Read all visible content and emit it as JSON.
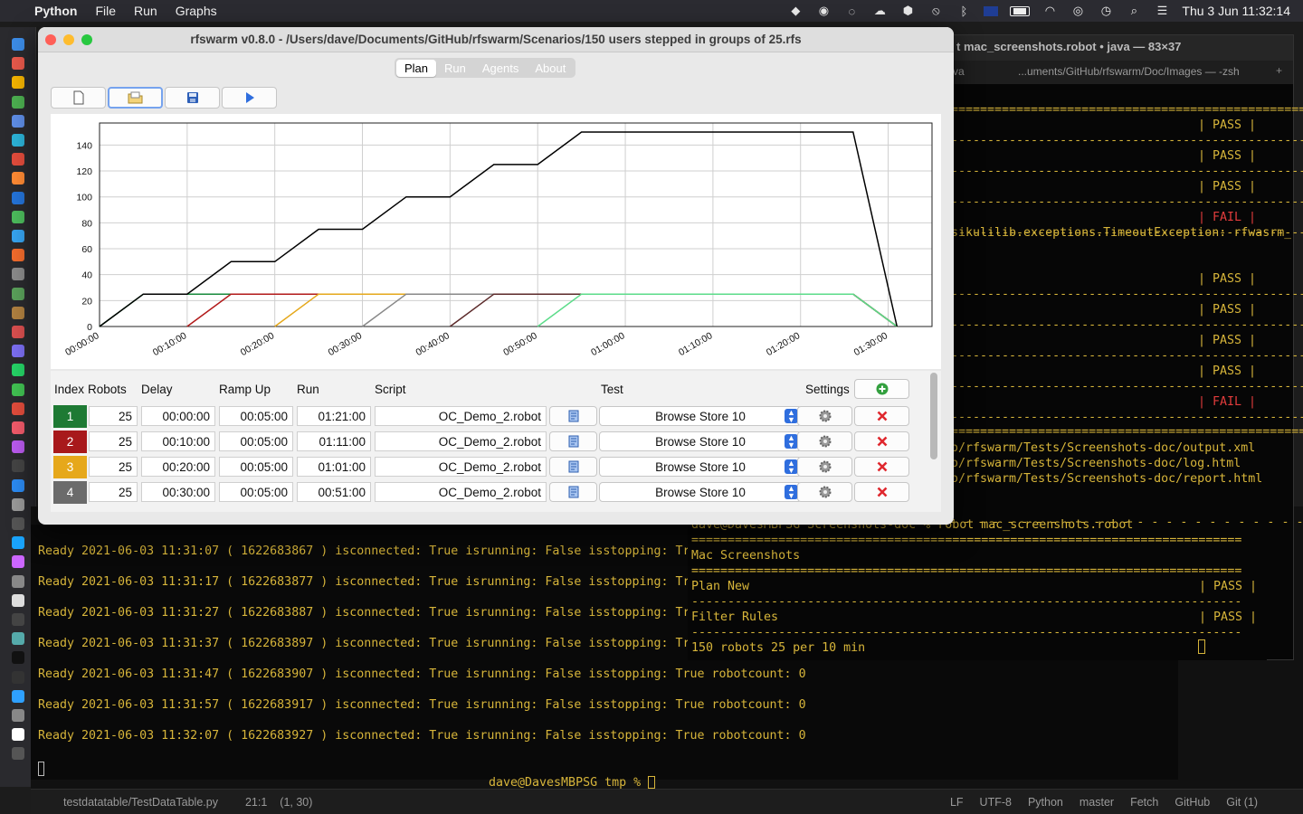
{
  "menubar": {
    "apple": "",
    "app": "Python",
    "menus": [
      "File",
      "Run",
      "Graphs"
    ],
    "clock": "Thu 3 Jun  11:32:14"
  },
  "window": {
    "title": "rfswarm v0.8.0 - /Users/dave/Documents/GitHub/rfswarm/Scenarios/150 users stepped in groups of 25.rfs",
    "tabs": [
      "Plan",
      "Run",
      "Agents",
      "About"
    ],
    "active_tab": "Plan"
  },
  "chart_data": {
    "type": "line",
    "xlabel": "",
    "ylabel": "",
    "xlim": [
      0,
      5700
    ],
    "ylim": [
      0,
      157
    ],
    "x_ticks": [
      "00:00:00",
      "00:10:00",
      "00:20:00",
      "00:30:00",
      "00:40:00",
      "00:50:00",
      "01:00:00",
      "01:10:00",
      "01:20:00",
      "01:30:00"
    ],
    "y_ticks": [
      0,
      20,
      40,
      60,
      80,
      100,
      120,
      140
    ],
    "grid": true,
    "series": [
      {
        "color": "#000000",
        "points": [
          [
            0,
            0
          ],
          [
            300,
            25
          ],
          [
            600,
            25
          ],
          [
            900,
            50
          ],
          [
            1200,
            50
          ],
          [
            1500,
            75
          ],
          [
            1800,
            75
          ],
          [
            2100,
            100
          ],
          [
            2400,
            100
          ],
          [
            2700,
            125
          ],
          [
            3000,
            125
          ],
          [
            3300,
            150
          ],
          [
            5160,
            150
          ],
          [
            5460,
            0
          ]
        ]
      },
      {
        "color": "#188a3c",
        "points": [
          [
            0,
            0
          ],
          [
            300,
            25
          ],
          [
            5160,
            25
          ],
          [
            5460,
            0
          ]
        ]
      },
      {
        "color": "#b21a1a",
        "points": [
          [
            600,
            0
          ],
          [
            900,
            25
          ],
          [
            5160,
            25
          ],
          [
            5460,
            0
          ]
        ]
      },
      {
        "color": "#e5a81b",
        "points": [
          [
            1200,
            0
          ],
          [
            1500,
            25
          ],
          [
            5160,
            25
          ],
          [
            5460,
            0
          ]
        ]
      },
      {
        "color": "#888888",
        "points": [
          [
            1800,
            0
          ],
          [
            2100,
            25
          ],
          [
            5160,
            25
          ],
          [
            5460,
            0
          ]
        ]
      },
      {
        "color": "#5c2a2a",
        "points": [
          [
            2400,
            0
          ],
          [
            2700,
            25
          ],
          [
            5160,
            25
          ],
          [
            5460,
            0
          ]
        ]
      },
      {
        "color": "#5cdc8a",
        "points": [
          [
            3000,
            0
          ],
          [
            3300,
            25
          ],
          [
            5160,
            25
          ],
          [
            5460,
            0
          ]
        ]
      }
    ]
  },
  "plan": {
    "headers": {
      "index": "Index",
      "robots": "Robots",
      "delay": "Delay",
      "rampup": "Ramp Up",
      "run": "Run",
      "script": "Script",
      "test": "Test",
      "settings": "Settings"
    },
    "rows": [
      {
        "index": "1",
        "color": "#1e7a34",
        "robots": "25",
        "delay": "00:00:00",
        "rampup": "00:05:00",
        "run": "01:21:00",
        "script": "OC_Demo_2.robot",
        "test": "Browse Store 10"
      },
      {
        "index": "2",
        "color": "#a8191b",
        "robots": "25",
        "delay": "00:10:00",
        "rampup": "00:05:00",
        "run": "01:11:00",
        "script": "OC_Demo_2.robot",
        "test": "Browse Store 10"
      },
      {
        "index": "3",
        "color": "#e6a81b",
        "robots": "25",
        "delay": "00:20:00",
        "rampup": "00:05:00",
        "run": "01:01:00",
        "script": "OC_Demo_2.robot",
        "test": "Browse Store 10"
      },
      {
        "index": "4",
        "color": "#6b6b6b",
        "robots": "25",
        "delay": "00:30:00",
        "rampup": "00:05:00",
        "run": "00:51:00",
        "script": "OC_Demo_2.robot",
        "test": "Browse Store 10"
      }
    ]
  },
  "term_left": {
    "lines": [
      "Ready 2021-06-03 11:31:07 ( 1622683867 ) isconnected: True isrunning: False isstopping: Tr",
      "Ready 2021-06-03 11:31:17 ( 1622683877 ) isconnected: True isrunning: False isstopping: Tr",
      "Ready 2021-06-03 11:31:27 ( 1622683887 ) isconnected: True isrunning: False isstopping: Tr",
      "Ready 2021-06-03 11:31:37 ( 1622683897 ) isconnected: True isrunning: False isstopping: Tr",
      "Ready 2021-06-03 11:31:47 ( 1622683907 ) isconnected: True isrunning: False isstopping: True robotcount: 0",
      "Ready 2021-06-03 11:31:57 ( 1622683917 ) isconnected: True isrunning: False isstopping: True robotcount: 0",
      "Ready 2021-06-03 11:32:07 ( 1622683927 ) isconnected: True isrunning: False isstopping: True robotcount: 0"
    ]
  },
  "term_right": {
    "title": "t mac_screenshots.robot • java — 83×37",
    "tab": "...uments/GitHub/rfswarm/Doc/Images — -zsh",
    "tab_left": "va",
    "plus": "+",
    "results": [
      "| PASS |",
      "| PASS |",
      "| PASS |",
      "| FAIL |",
      "| PASS |",
      "| PASS |",
      "| PASS |",
      "| PASS |",
      "| FAIL |"
    ],
    "exception": "sikulilib.exceptions.TimeoutException: rfwasrm_",
    "paths": [
      "o/rfswarm/Tests/Screenshots-doc/output.xml",
      "o/rfswarm/Tests/Screenshots-doc/log.html",
      "o/rfswarm/Tests/Screenshots-doc/report.html"
    ]
  },
  "term_mid": {
    "command": "dave@DavesMBPSG Screenshots-doc % robot mac_screenshots.robot",
    "suite": "Mac Screenshots",
    "tests": [
      {
        "name": "Plan New",
        "result": "| PASS |"
      },
      {
        "name": "Filter Rules",
        "result": "| PASS |"
      }
    ],
    "running": "150 robots 25 per 10 min"
  },
  "term_bottom": {
    "prompt": "dave@DavesMBPSG tmp % "
  },
  "statusbar": {
    "file": "testdatatable/TestDataTable.py",
    "pos": "21:1",
    "sel": "(1, 30)",
    "right": [
      "LF",
      "UTF-8",
      "Python",
      "master",
      "Fetch",
      "GitHub",
      "Git (1)"
    ]
  }
}
